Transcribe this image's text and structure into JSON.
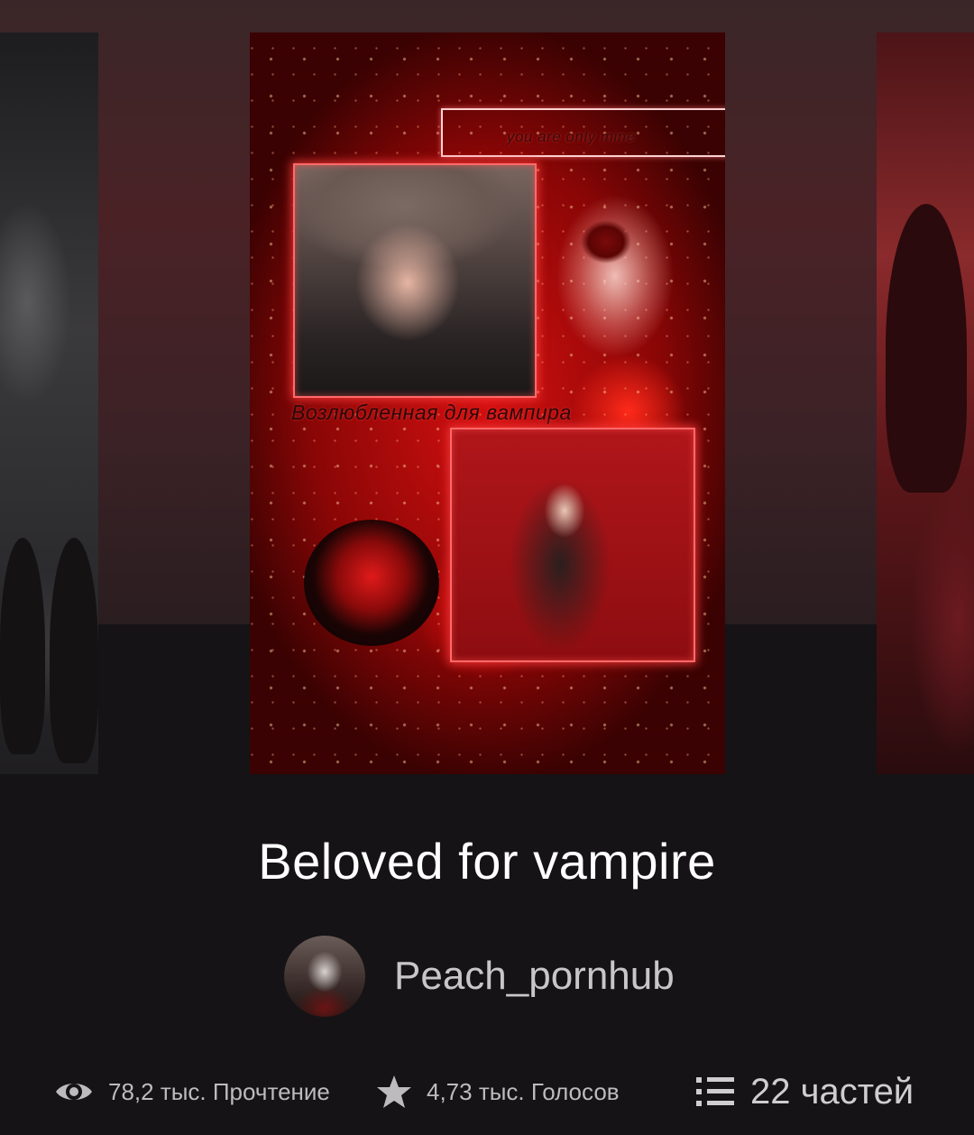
{
  "story": {
    "title": "Beloved for vampire",
    "author": "Peach_pornhub",
    "cover_text_top": "you are only mine",
    "cover_text_middle": "Возлюбленная для вампира"
  },
  "stats": {
    "views": "78,2 тыс. Прочтение",
    "votes": "4,73 тыс. Голосов",
    "parts": "22 частей"
  },
  "icons": {
    "views": "eye-icon",
    "votes": "star-icon",
    "parts": "list-icon"
  },
  "colors": {
    "background": "#151315",
    "title": "#ffffff",
    "meta_text": "#bdbbbd",
    "cover_accent": "#d41010"
  }
}
